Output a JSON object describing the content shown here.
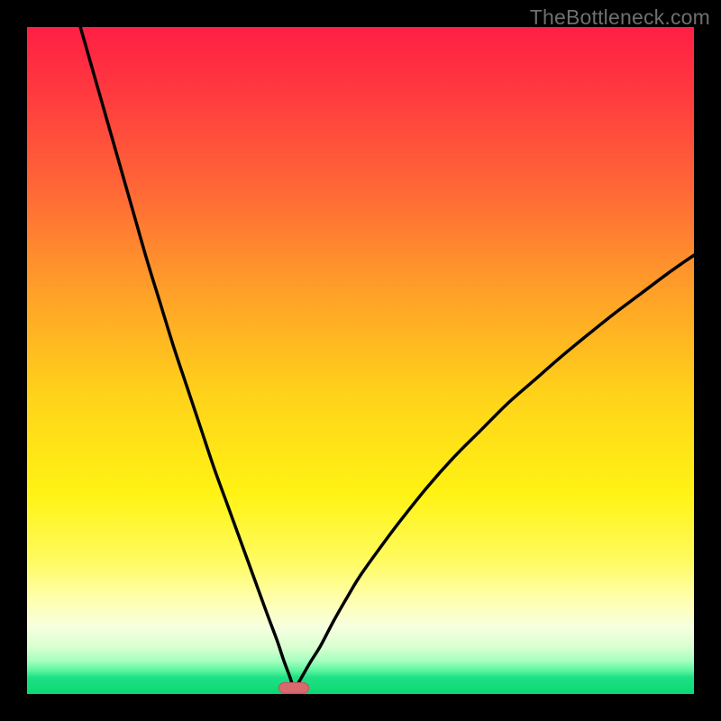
{
  "watermark": {
    "text": "TheBottleneck.com"
  },
  "colors": {
    "gradient_stops": [
      {
        "offset": 0.0,
        "color": "#ff1f44"
      },
      {
        "offset": 0.1,
        "color": "#ff3a3f"
      },
      {
        "offset": 0.25,
        "color": "#ff6a36"
      },
      {
        "offset": 0.4,
        "color": "#ffa128"
      },
      {
        "offset": 0.55,
        "color": "#ffd21a"
      },
      {
        "offset": 0.7,
        "color": "#fff314"
      },
      {
        "offset": 0.8,
        "color": "#fffb60"
      },
      {
        "offset": 0.86,
        "color": "#ffffb0"
      },
      {
        "offset": 0.9,
        "color": "#f6ffe0"
      },
      {
        "offset": 0.93,
        "color": "#d8ffd0"
      },
      {
        "offset": 0.95,
        "color": "#a6ffc0"
      },
      {
        "offset": 0.965,
        "color": "#5cf59e"
      },
      {
        "offset": 0.975,
        "color": "#1ee085"
      },
      {
        "offset": 1.0,
        "color": "#0cd873"
      }
    ],
    "curve": "#000000",
    "marker_fill": "#d86a6f",
    "marker_stroke": "#c25258"
  },
  "chart_data": {
    "type": "line",
    "title": "",
    "xlabel": "",
    "ylabel": "",
    "xlim": [
      0,
      100
    ],
    "ylim": [
      0,
      100
    ],
    "x_minimum": 40,
    "series": [
      {
        "name": "left-branch",
        "x": [
          8,
          10,
          12,
          14,
          16,
          18,
          20,
          22,
          24,
          26,
          28,
          30,
          32,
          34,
          36,
          37.5,
          38.5,
          39.5,
          40
        ],
        "values": [
          100,
          93,
          86,
          79,
          72,
          65,
          58.5,
          52,
          46,
          40,
          34,
          28.5,
          23,
          17.5,
          12,
          8,
          5,
          2.3,
          0.5
        ]
      },
      {
        "name": "right-branch",
        "x": [
          40,
          41,
          42.5,
          44,
          46,
          48,
          50,
          53,
          56,
          60,
          64,
          68,
          72,
          76,
          80,
          84,
          88,
          92,
          96,
          100
        ],
        "values": [
          0.5,
          2.2,
          4.8,
          7.2,
          11,
          14.5,
          17.8,
          22,
          26,
          31,
          35.5,
          39.5,
          43.5,
          47,
          50.5,
          53.8,
          57,
          60,
          63,
          65.8
        ]
      }
    ],
    "marker": {
      "x_center": 40,
      "width": 4.5,
      "y": 0.1,
      "height": 1.6,
      "rx": 0.9
    }
  }
}
